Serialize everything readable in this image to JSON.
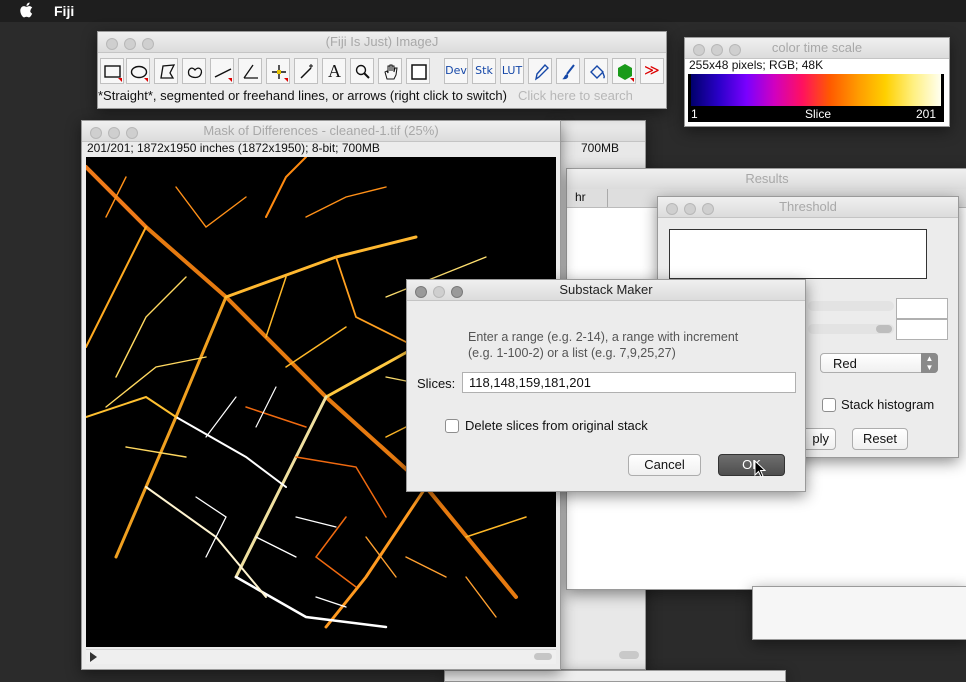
{
  "menubar": {
    "app_name": "Fiji"
  },
  "imagej": {
    "title": "(Fiji Is Just) ImageJ",
    "tool_labels": {
      "dev": "Dev",
      "stk": "Stk",
      "lut": "LUT",
      "text_tool": "A",
      "more": "≫"
    },
    "status": "*Straight*, segmented or freehand lines, or arrows (right click to switch)",
    "search_placeholder": "Click here to search"
  },
  "color_time_scale": {
    "title": "color time scale",
    "info": "255x48 pixels; RGB; 48K",
    "min_label": "1",
    "mid_label": "Slice",
    "max_label": "201"
  },
  "image_window": {
    "title": "Mask of Differences - cleaned-1.tif (25%)",
    "info": "201/201; 1872x1950 inches (1872x1950); 8-bit; 700MB",
    "back_info": "700MB"
  },
  "results": {
    "title": "Results",
    "column_fragment": "hr"
  },
  "threshold": {
    "title": "Threshold",
    "mode_value": "Red",
    "stack_histogram_label": "Stack histogram",
    "apply_label": "ply",
    "reset_label": "Reset"
  },
  "substack": {
    "title": "Substack Maker",
    "instruction_line1": "Enter a range (e.g. 2-14), a range with increment",
    "instruction_line2": "(e.g. 1-100-2) or a list (e.g. 7,9,25,27)",
    "slices_label": "Slices:",
    "slices_value": "118,148,159,181,201",
    "delete_label": "Delete slices from original stack",
    "delete_checked": false,
    "cancel_label": "Cancel",
    "ok_label": "OK"
  }
}
